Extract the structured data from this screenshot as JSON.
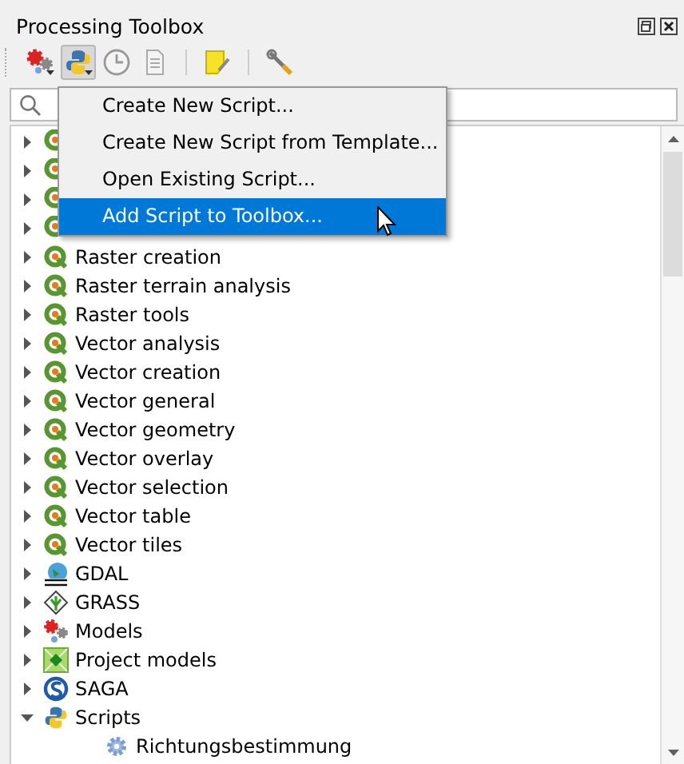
{
  "panel": {
    "title": "Processing Toolbox"
  },
  "toolbar": [
    {
      "kind": "models",
      "pressed": false,
      "dropdown": true
    },
    {
      "kind": "python",
      "pressed": true,
      "dropdown": true
    },
    {
      "kind": "history",
      "pressed": false,
      "dropdown": false
    },
    {
      "kind": "results",
      "pressed": false,
      "dropdown": false
    },
    {
      "kind": "sep"
    },
    {
      "kind": "edit",
      "pressed": false,
      "dropdown": false
    },
    {
      "kind": "sep"
    },
    {
      "kind": "options",
      "pressed": false,
      "dropdown": false
    }
  ],
  "menu": [
    {
      "label": "Create New Script...",
      "selected": false
    },
    {
      "label": "Create New Script from Template...",
      "selected": false
    },
    {
      "label": "Open Existing Script...",
      "selected": false
    },
    {
      "label": "Add Script to Toolbox...",
      "selected": true
    }
  ],
  "tree": [
    {
      "kind": "qgis",
      "expanded": false
    },
    {
      "kind": "qgis",
      "expanded": false
    },
    {
      "kind": "qgis",
      "expanded": false
    },
    {
      "kind": "qgis",
      "expanded": false
    },
    {
      "kind": "qgis",
      "label": "Raster creation",
      "expanded": false
    },
    {
      "kind": "qgis",
      "label": "Raster terrain analysis",
      "expanded": false
    },
    {
      "kind": "qgis",
      "label": "Raster tools",
      "expanded": false
    },
    {
      "kind": "qgis",
      "label": "Vector analysis",
      "expanded": false
    },
    {
      "kind": "qgis",
      "label": "Vector creation",
      "expanded": false
    },
    {
      "kind": "qgis",
      "label": "Vector general",
      "expanded": false
    },
    {
      "kind": "qgis",
      "label": "Vector geometry",
      "expanded": false
    },
    {
      "kind": "qgis",
      "label": "Vector overlay",
      "expanded": false
    },
    {
      "kind": "qgis",
      "label": "Vector selection",
      "expanded": false
    },
    {
      "kind": "qgis",
      "label": "Vector table",
      "expanded": false
    },
    {
      "kind": "qgis",
      "label": "Vector tiles",
      "expanded": false
    },
    {
      "kind": "gdal",
      "label": "GDAL",
      "expanded": false
    },
    {
      "kind": "grass",
      "label": "GRASS",
      "expanded": false
    },
    {
      "kind": "models",
      "label": "Models",
      "expanded": false
    },
    {
      "kind": "project",
      "label": "Project models",
      "expanded": false
    },
    {
      "kind": "saga",
      "label": "SAGA",
      "expanded": false
    },
    {
      "kind": "python",
      "label": "Scripts",
      "expanded": true,
      "children": [
        {
          "kind": "script",
          "label": "Richtungsbestimmung"
        }
      ]
    }
  ]
}
